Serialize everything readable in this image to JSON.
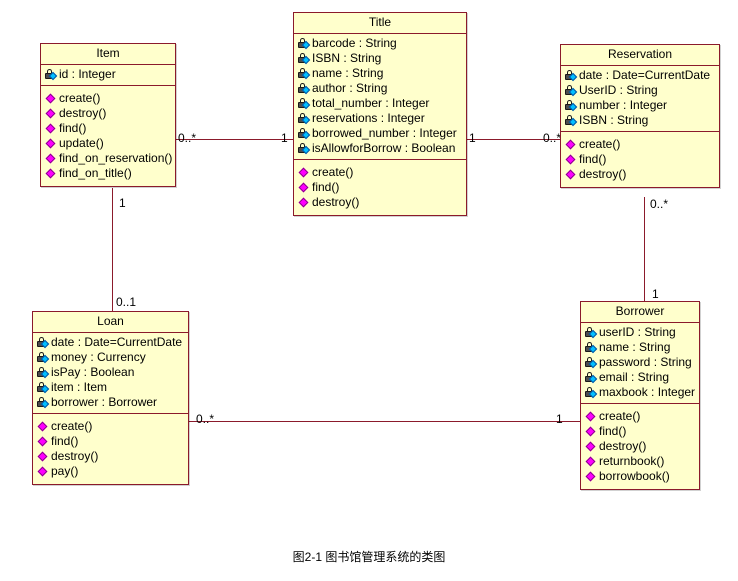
{
  "diagram": {
    "caption": "图2-1 图书馆管理系统的类图",
    "colors": {
      "box_fill": "#ffffcc",
      "box_border": "#8b1a2b",
      "line": "#8b1a2b",
      "attribute_icon": "#00bfff",
      "operation_icon": "#ff00ff",
      "text": "#000000",
      "background": "#ffffff"
    }
  },
  "classes": {
    "item": {
      "name": "Item",
      "attributes": [
        {
          "icon": "private-lock-icon",
          "text": "id : Integer"
        }
      ],
      "operations": [
        {
          "icon": "operation-diamond-icon",
          "text": "create()"
        },
        {
          "icon": "operation-diamond-icon",
          "text": "destroy()"
        },
        {
          "icon": "operation-diamond-icon",
          "text": "find()"
        },
        {
          "icon": "operation-diamond-icon",
          "text": "update()"
        },
        {
          "icon": "operation-diamond-icon",
          "text": "find_on_reservation()"
        },
        {
          "icon": "operation-diamond-icon",
          "text": "find_on_title()"
        }
      ]
    },
    "title": {
      "name": "Title",
      "attributes": [
        {
          "icon": "private-lock-icon",
          "text": "barcode : String"
        },
        {
          "icon": "private-lock-icon",
          "text": "ISBN : String"
        },
        {
          "icon": "private-lock-icon",
          "text": "name : String"
        },
        {
          "icon": "private-lock-icon",
          "text": "author : String"
        },
        {
          "icon": "private-lock-icon",
          "text": "total_number : Integer"
        },
        {
          "icon": "private-lock-icon",
          "text": "reservations : Integer"
        },
        {
          "icon": "private-lock-icon",
          "text": "borrowed_number : Integer"
        },
        {
          "icon": "private-lock-icon",
          "text": "isAllowforBorrow : Boolean"
        }
      ],
      "operations": [
        {
          "icon": "operation-diamond-icon",
          "text": "create()"
        },
        {
          "icon": "operation-diamond-icon",
          "text": "find()"
        },
        {
          "icon": "operation-diamond-icon",
          "text": "destroy()"
        }
      ]
    },
    "reservation": {
      "name": "Reservation",
      "attributes": [
        {
          "icon": "private-lock-icon",
          "text": "date : Date=CurrentDate"
        },
        {
          "icon": "private-lock-icon",
          "text": "UserID : String"
        },
        {
          "icon": "private-lock-icon",
          "text": "number : Integer"
        },
        {
          "icon": "private-lock-icon",
          "text": "ISBN : String"
        }
      ],
      "operations": [
        {
          "icon": "operation-diamond-icon",
          "text": "create()"
        },
        {
          "icon": "operation-diamond-icon",
          "text": "find()"
        },
        {
          "icon": "operation-diamond-icon",
          "text": "destroy()"
        }
      ]
    },
    "loan": {
      "name": "Loan",
      "attributes": [
        {
          "icon": "private-lock-icon",
          "text": "date : Date=CurrentDate"
        },
        {
          "icon": "private-lock-icon",
          "text": "money : Currency"
        },
        {
          "icon": "private-lock-icon",
          "text": "isPay : Boolean"
        },
        {
          "icon": "private-lock-icon",
          "text": "item : Item"
        },
        {
          "icon": "private-lock-icon",
          "text": "borrower : Borrower"
        }
      ],
      "operations": [
        {
          "icon": "operation-diamond-icon",
          "text": "create()"
        },
        {
          "icon": "operation-diamond-icon",
          "text": "find()"
        },
        {
          "icon": "operation-diamond-icon",
          "text": "destroy()"
        },
        {
          "icon": "operation-diamond-icon",
          "text": "pay()"
        }
      ]
    },
    "borrower": {
      "name": "Borrower",
      "attributes": [
        {
          "icon": "private-lock-icon",
          "text": "userID : String"
        },
        {
          "icon": "private-lock-icon",
          "text": "name : String"
        },
        {
          "icon": "private-lock-icon",
          "text": "password : String"
        },
        {
          "icon": "private-lock-icon",
          "text": "email : String"
        },
        {
          "icon": "private-lock-icon",
          "text": "maxbook : Integer"
        }
      ],
      "operations": [
        {
          "icon": "operation-diamond-icon",
          "text": "create()"
        },
        {
          "icon": "operation-diamond-icon",
          "text": "find()"
        },
        {
          "icon": "operation-diamond-icon",
          "text": "destroy()"
        },
        {
          "icon": "operation-diamond-icon",
          "text": "returnbook()"
        },
        {
          "icon": "operation-diamond-icon",
          "text": "borrowbook()"
        }
      ]
    }
  },
  "associations": [
    {
      "id": "item-title",
      "from": "Item",
      "to": "Title",
      "from_mult": "0..*",
      "to_mult": "1"
    },
    {
      "id": "title-reservation",
      "from": "Title",
      "to": "Reservation",
      "from_mult": "1",
      "to_mult": "0..*"
    },
    {
      "id": "item-loan",
      "from": "Item",
      "to": "Loan",
      "from_mult": "1",
      "to_mult": "0..1"
    },
    {
      "id": "reservation-borrower",
      "from": "Reservation",
      "to": "Borrower",
      "from_mult": "0..*",
      "to_mult": "1"
    },
    {
      "id": "loan-borrower",
      "from": "Loan",
      "to": "Borrower",
      "from_mult": "0..*",
      "to_mult": "1"
    }
  ]
}
